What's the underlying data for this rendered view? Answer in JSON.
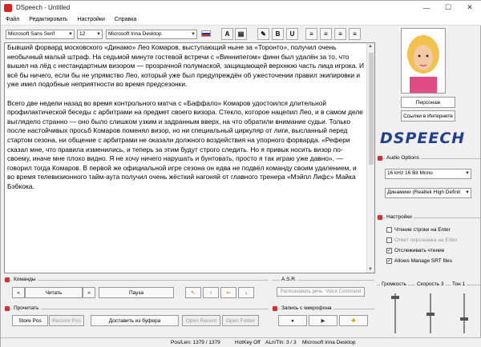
{
  "window": {
    "title": "DSpeech - Untitled"
  },
  "menu": [
    "Файл",
    "Редактировать",
    "Настройки",
    "Справка"
  ],
  "toolbar": {
    "font": "Microsoft Sans Serif",
    "size": "12",
    "voice": "Microsoft Irina Desktop",
    "bold": "B",
    "underline": "U"
  },
  "editor": {
    "text": "Бывший форвард московского «Динамо» Лео Комаров, выступающий ныне за «Торонто», получил очень необычный малый штраф. На седьмой минуте гостевой встречи с «Виннипегом» финн был удалён за то, что вышел на лёд с нестандартным визором — прозрачной полумаской, защищающей верхнюю часть лица игрока. И всё бы ничего, если бы не упрямство Лео, который уже был предупреждён об ужесточении правил экипировки и уже имел подобные неприятности во время предсезонки.\n\nВсего две недели назад во время контрольного матча с «Баффало» Комаров удостоился длительной профилактической беседы с арбитрами на предмет своего визора. Стекло, которое нацепил Лео, и в самом деле выглядело странно — оно было слишком узким и задранным вверх, на что обратили внимание судьи. Только после настойчивых просьб Комаров поменял визор, но ни специальный циркуляр от лиги, высланный перед стартом сезона, ни общение с арбитрами не оказали должного воздействия на упорного форварда. «Рефери сказал мне, что правила изменились, и теперь за этим будут строго следить. Но я привык носить визор по-своему, иначе мне плохо видно. Я не хочу ничего нарушать и бунтовать, просто я так играю уже давно», — говорил тогда Комаров. В первой же официальной игре сезона он едва не подвёл команду своим удалением, и во время телевизионного тайм-аута получил очень жёсткий нагоняй от главного тренера «Мэйпл Лифс» Майка Бэбкока."
  },
  "right": {
    "persona": "Персонаж",
    "links": "Ссылки в Интернете",
    "logo": "DSPEECH",
    "audio_title": "Audio Options",
    "audio_format": "16 kHz 16 Bit Mono",
    "audio_device": "Динамики (Realtek High Definit",
    "settings_title": "Настройки",
    "chk1": "Чтение строки на Enter",
    "chk2": "Ответ персонажа на Enter",
    "chk3": "Отслеживать чтение",
    "chk4": "Allows Manage SRT files",
    "sliders": [
      "Громкость",
      "Скорость 3",
      "Тон 1"
    ]
  },
  "commands": {
    "title": "Команды",
    "read": "Читать",
    "pause": "Пауза"
  },
  "asr": {
    "title": "A.S.R.",
    "recognize": "Распознавать речь",
    "voice_command": "Voice Command"
  },
  "read2": {
    "title": "Прочитать",
    "store": "Store Pos",
    "restore": "Restore Pos",
    "buffer": "Доставить из буфера",
    "open_recent": "Open Recent",
    "open_folder": "Open Folder"
  },
  "mic": {
    "title": "Запись с микрофона"
  },
  "status": {
    "pos": "Pos/Len: 1379 / 1379",
    "hotkey": "HotKey Off",
    "aln": "ALn/Tln: 3 / 3",
    "voice": "Microsoft Irina Desktop"
  }
}
